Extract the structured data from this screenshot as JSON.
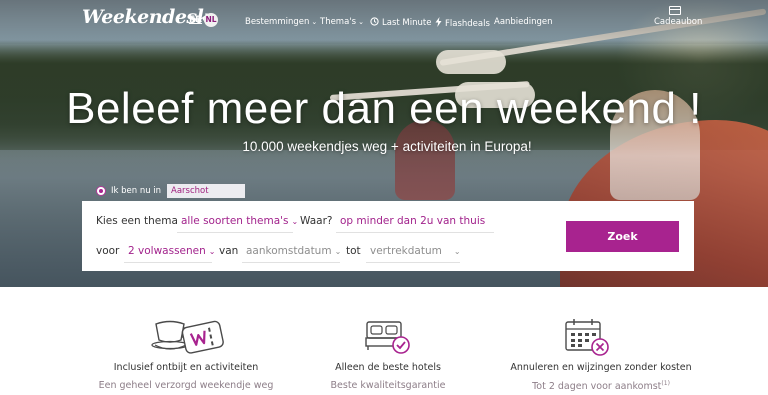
{
  "header": {
    "logo": "Weekendesk",
    "lang_fr": "FR",
    "lang_nl": "NL",
    "nav": [
      {
        "label": "Bestemmingen",
        "icon": "",
        "caret": "⌄"
      },
      {
        "label": "Thema's",
        "icon": "",
        "caret": "⌄"
      },
      {
        "label": "Last Minute",
        "icon": "clock-icon",
        "caret": ""
      },
      {
        "label": "Flashdeals",
        "icon": "lightning-icon",
        "caret": ""
      },
      {
        "label": "Aanbiedingen",
        "icon": "",
        "caret": ""
      }
    ],
    "cadeaubon_label": "Cadeaubon"
  },
  "hero": {
    "headline": "Beleef meer dan een weekend !",
    "subline": "10.000 weekendjes weg + activiteiten in Europa!"
  },
  "search": {
    "location_label": "Ik ben nu in",
    "location_value": "Aarschot",
    "theme_label": "Kies een thema",
    "theme_value": "alle soorten thema's",
    "where_label": "Waar?",
    "where_value": "op minder dan 2u van thuis",
    "for_label": "voor",
    "guests_value": "2 volwassenen",
    "from_label": "van",
    "arrival_placeholder": "aankomstdatum",
    "to_label": "tot",
    "departure_placeholder": "vertrekdatum",
    "submit_label": "Zoek"
  },
  "features": [
    {
      "title": "Inclusief ontbijt en activiteiten",
      "subtitle": "Een geheel verzorgd weekendje weg",
      "icon": "breakfast-voucher-icon"
    },
    {
      "title": "Alleen de beste hotels",
      "subtitle": "Beste kwaliteitsgarantie",
      "icon": "hotel-bed-icon"
    },
    {
      "title": "Annuleren en wijzingen zonder kosten",
      "subtitle": "Tot 2 dagen voor aankomst",
      "footnote": "(1)",
      "icon": "calendar-cancel-icon"
    }
  ],
  "colors": {
    "accent": "#a8238f",
    "muted_text": "#8d7e88"
  }
}
